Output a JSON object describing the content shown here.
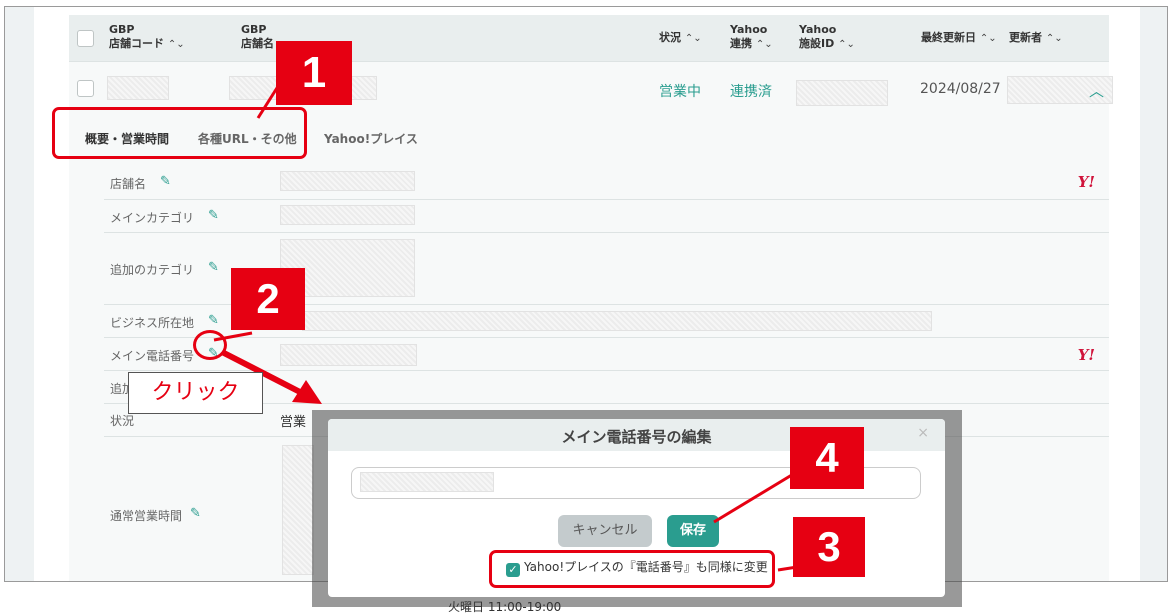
{
  "header": {
    "col_gbp_code": [
      "GBP",
      "店舗コード"
    ],
    "col_gbp_name": [
      "GBP",
      "店舗名"
    ],
    "col_status": "状況",
    "col_yahoo_link": [
      "Yahoo",
      "連携"
    ],
    "col_yahoo_id": [
      "Yahoo",
      "施設ID"
    ],
    "col_updated": "最終更新日",
    "col_updater": "更新者"
  },
  "row": {
    "status": "営業中",
    "linked": "連携済",
    "updated": "2024/08/27"
  },
  "tabs": [
    {
      "label": "概要・営業時間",
      "active": true
    },
    {
      "label": "各種URL・その他",
      "active": false
    },
    {
      "label": "Yahoo!プレイス",
      "active": false
    }
  ],
  "details": [
    {
      "label": "店舗名",
      "yahoo": true
    },
    {
      "label": "メインカテゴリ",
      "yahoo": false
    },
    {
      "label": "追加のカテゴリ",
      "yahoo": false
    },
    {
      "label": "ビジネス所在地",
      "yahoo": false
    },
    {
      "label": "メイン電話番号",
      "yahoo": true
    },
    {
      "label": "追加",
      "yahoo": false
    },
    {
      "label": "状況",
      "yahoo": false
    },
    {
      "label": "通常営業時間",
      "yahoo": false
    }
  ],
  "status_value_partial": "営業",
  "hours_partial": "火曜日 11:00-19:00",
  "yahoo_icon": "Y!",
  "modal": {
    "title": "メイン電話番号の編集",
    "close": "×",
    "cancel_label": "キャンセル",
    "save_label": "保存",
    "checkbox_label": "Yahoo!プレイスの『電話番号』も同様に変更",
    "checked": true
  },
  "annotations": {
    "step1": "1",
    "step2": "2",
    "step3": "3",
    "step4": "4",
    "click_label": "クリック"
  },
  "colors": {
    "accent": "#2a9d8f",
    "callout": "#e60012",
    "yahoo": "#d0133a"
  }
}
